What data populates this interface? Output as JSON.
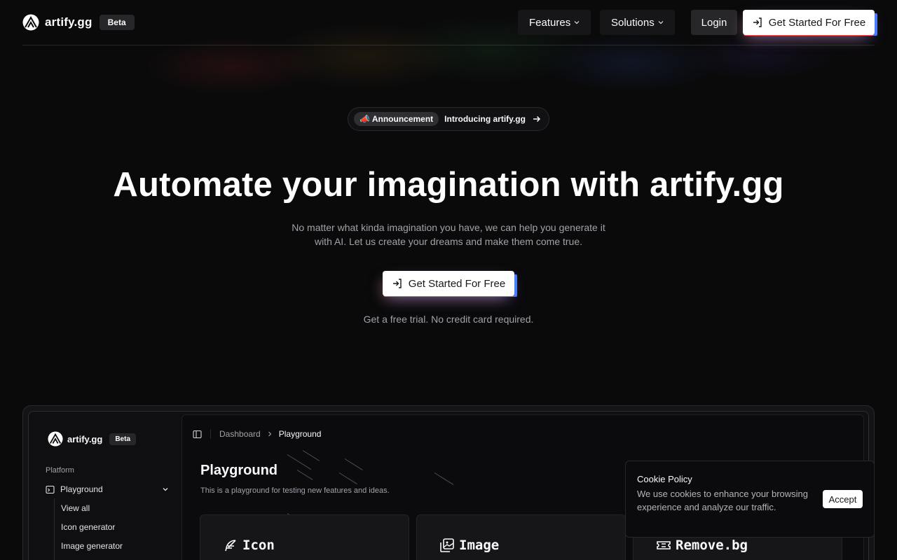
{
  "header": {
    "brand": "artify.gg",
    "badge": "Beta",
    "nav": [
      {
        "label": "Features"
      },
      {
        "label": "Solutions"
      }
    ],
    "login_label": "Login",
    "cta_label": "Get Started For Free"
  },
  "hero": {
    "announcement_tag": "📣 Announcement",
    "announcement_text": "Introducing artify.gg",
    "title": "Automate your imagination with artify.gg",
    "subtitle": "No matter what kinda imagination you have, we can help you generate it with AI. Let us create your dreams and make them come true.",
    "cta_label": "Get Started For Free",
    "note": "Get a free trial. No credit card required."
  },
  "preview": {
    "brand": "artify.gg",
    "badge": "Beta",
    "section_label": "Platform",
    "nav_group": "Playground",
    "nav_items": [
      "View all",
      "Icon generator",
      "Image generator"
    ],
    "breadcrumb": [
      "Dashboard",
      "Playground"
    ],
    "title": "Playground",
    "description": "This is a playground for testing new features and ideas.",
    "cards": [
      "Icon",
      "Image",
      "Remove.bg"
    ]
  },
  "cookie": {
    "title": "Cookie Policy",
    "text": "We use cookies to enhance your browsing experience and analyze our traffic.",
    "accept_label": "Accept"
  },
  "colors": {
    "background": "#0a0a0b",
    "muted_text": "#a1a1aa",
    "button_dark": "#27272a",
    "button_light": "#ffffff"
  }
}
